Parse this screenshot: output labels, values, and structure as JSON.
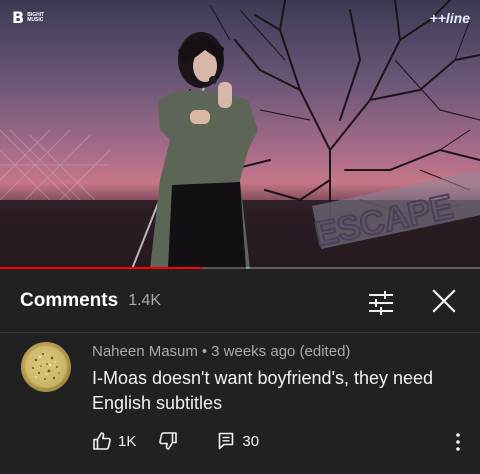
{
  "video": {
    "channel_logo_mark": "B",
    "channel_logo_text_line1": "BIGHIT",
    "channel_logo_text_line2": "MUSIC",
    "stream_logo": "++line",
    "stream_logo_sub": "",
    "stage_sign": "ESCAPE",
    "progress_fraction": 0.42,
    "colors": {
      "progress": "#ff0000"
    }
  },
  "comments_header": {
    "title": "Comments",
    "count": "1.4K",
    "filter_icon": "filter-sliders-icon",
    "close_icon": "close-icon"
  },
  "comment": {
    "author": "Naheen Masum",
    "separator": "•",
    "time": "3 weeks ago (edited)",
    "text_line1": "I-Moas doesn't want boyfriend's, they need",
    "text_line2": "English subtitles",
    "like_count": "1K",
    "reply_count": "30",
    "icons": {
      "like": "thumbs-up-icon",
      "dislike": "thumbs-down-icon",
      "reply": "reply-comment-icon",
      "more": "more-vertical-icon"
    }
  }
}
